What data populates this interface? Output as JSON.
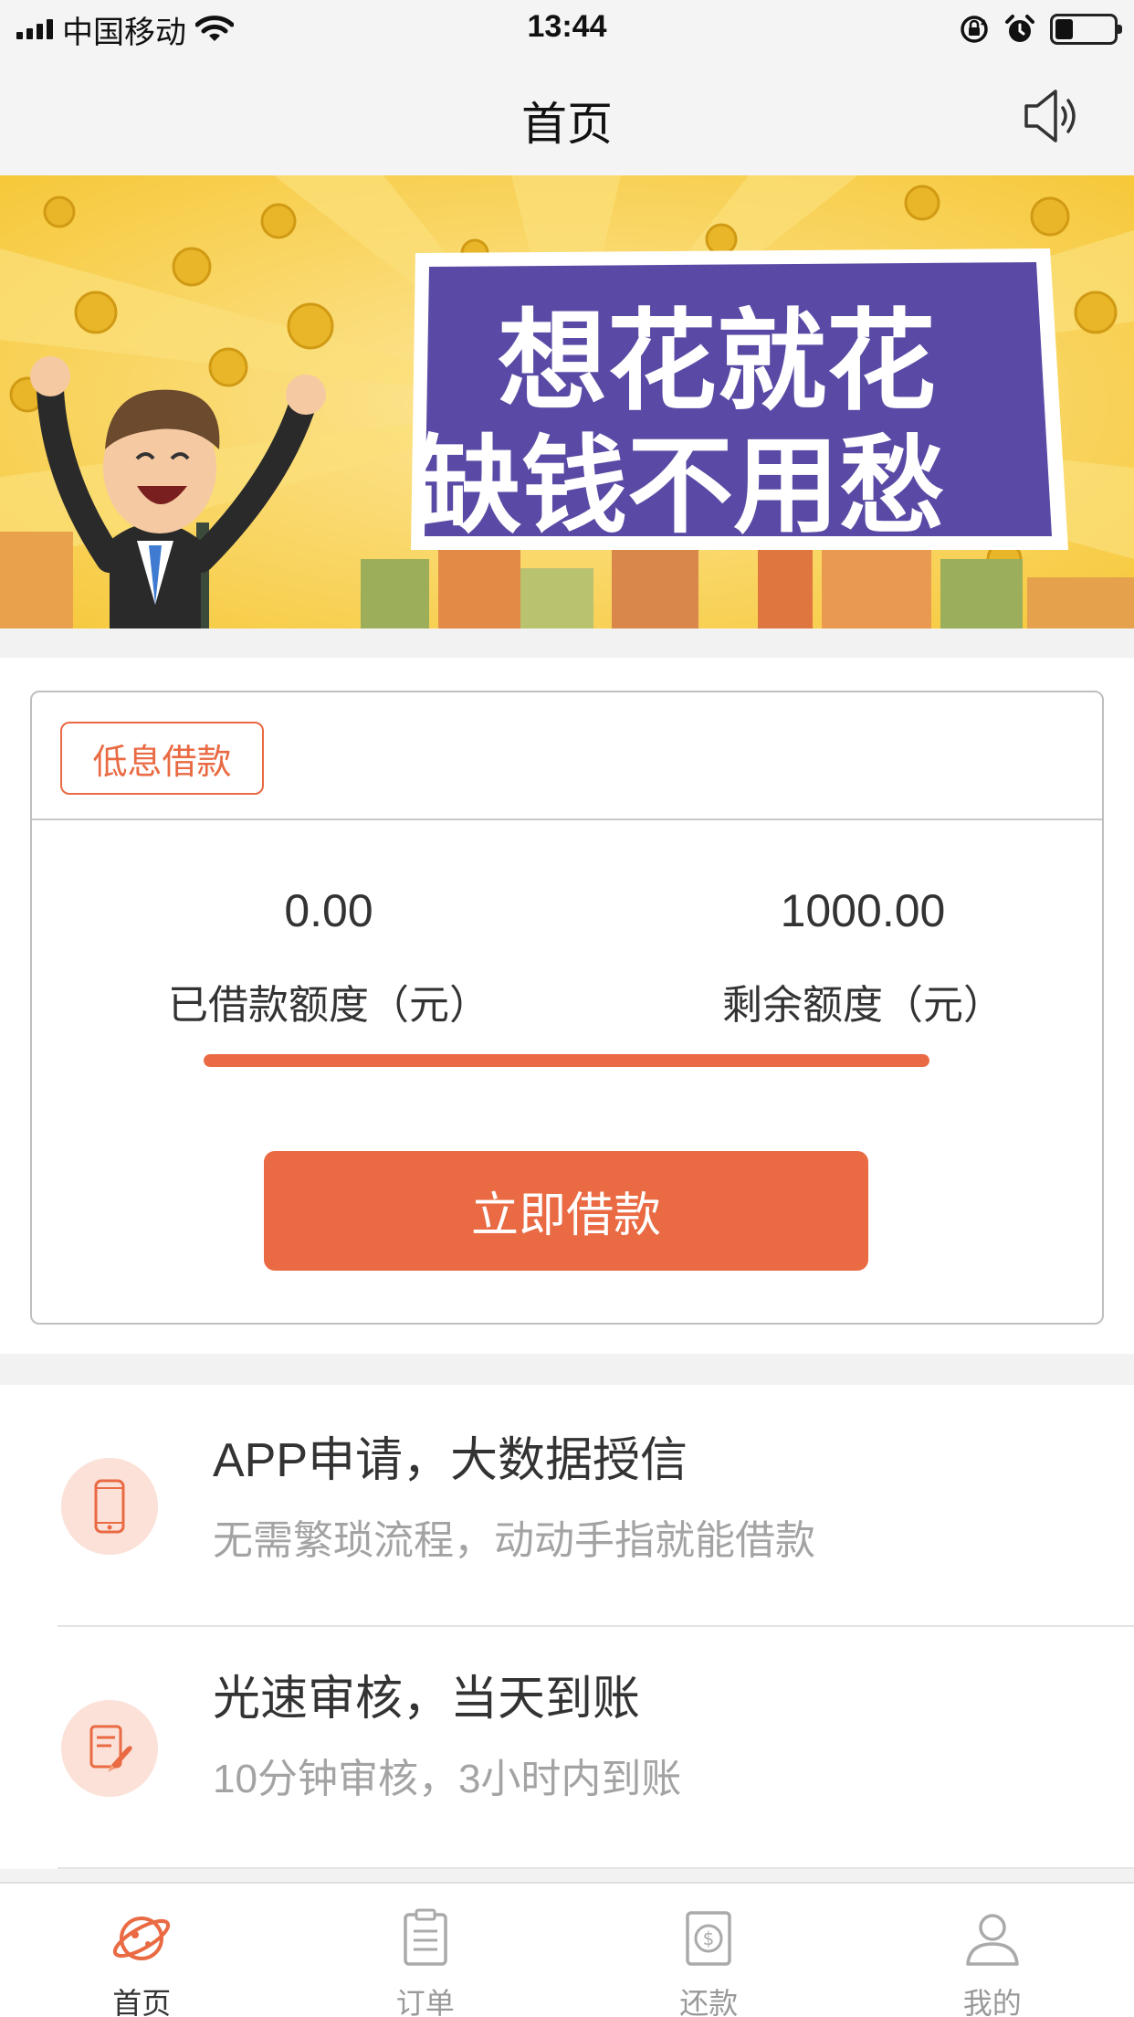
{
  "status_bar": {
    "carrier": "中国移动",
    "time": "13:44",
    "battery_level": 0.3,
    "icons": [
      "signal-icon",
      "wifi-icon",
      "rotation-lock-icon",
      "alarm-icon",
      "battery-icon"
    ]
  },
  "nav": {
    "title": "首页",
    "right_icon": "speaker-icon"
  },
  "banner": {
    "line1": "想花就花",
    "line2": "缺钱不用愁",
    "colors": {
      "background": "#f9d34a",
      "panel": "#5b4aa5",
      "highlight": "#f4c21c"
    }
  },
  "loan_card": {
    "tag": "低息借款",
    "borrowed_value": "0.00",
    "borrowed_label": "已借款额度（元）",
    "remaining_value": "1000.00",
    "remaining_label": "剩余额度（元）",
    "remaining_fraction": 1.0,
    "button": "立即借款",
    "accent": "#e96a43"
  },
  "features": [
    {
      "icon": "phone-icon",
      "title": "APP申请，大数据授信",
      "subtitle": "无需繁琐流程，动动手指就能借款"
    },
    {
      "icon": "document-rocket-icon",
      "title": "光速审核，当天到账",
      "subtitle": "10分钟审核，3小时内到账"
    }
  ],
  "tabs": [
    {
      "label": "首页",
      "icon": "planet-icon",
      "active": true
    },
    {
      "label": "订单",
      "icon": "clipboard-icon",
      "active": false
    },
    {
      "label": "还款",
      "icon": "repay-icon",
      "active": false
    },
    {
      "label": "我的",
      "icon": "user-icon",
      "active": false
    }
  ]
}
